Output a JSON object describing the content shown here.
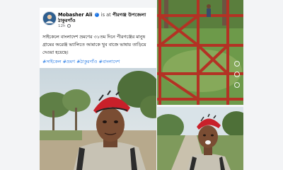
{
  "post": {
    "author": "Mobasher Ali",
    "verified_mark": "✓",
    "separator": "is",
    "at_word": "at",
    "location_line1": "পীরগঞ্জ উপজেলা",
    "location_line2": "ঠাকুরগাঁও",
    "time": "12h",
    "privacy_icon": "globe-icon",
    "text": "সাইকেলে বাংলাদেশ ভ্রমণের ৩১তম দিনে পীরগঞ্জের মানুষ গ্রামের অরেঞ্জ ভ্যালিতে আমাকে খুব বাজে ভাষায় তাড়িয়ে দেওয়া হয়েছে।",
    "hashtags": "#সাইকেল #ভ্রমণ #ঠাকুরগাঁও #বাংলাদেশ"
  },
  "colors": {
    "link": "#1b74e4",
    "helmet": "#c8202a",
    "frame": "#b33224"
  },
  "icons": {
    "avatar": "avatar-icon",
    "side": [
      "like-icon",
      "comment-icon",
      "share-icon"
    ]
  }
}
